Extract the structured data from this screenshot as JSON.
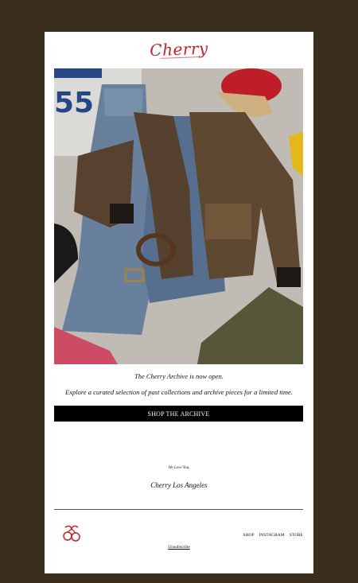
{
  "brand": {
    "logo_text": "Cherry"
  },
  "hero": {
    "image_name": "archive-flatlay"
  },
  "content": {
    "tagline": "The Cherry Archive is now open.",
    "description": "Explore a curated selection of past collections and archive pieces for a limited time.",
    "cta_label": "SHOP THE ARCHIVE"
  },
  "signoff": {
    "love": "We Love You,",
    "signature": "Cherry Los Angeles"
  },
  "footer": {
    "nav": [
      "SHOP",
      "INSTAGRAM",
      "STORE"
    ],
    "unsubscribe": "Unsubscribe"
  },
  "colors": {
    "background": "#3a2f1f",
    "brand_red": "#c4212a",
    "button": "#000000"
  }
}
